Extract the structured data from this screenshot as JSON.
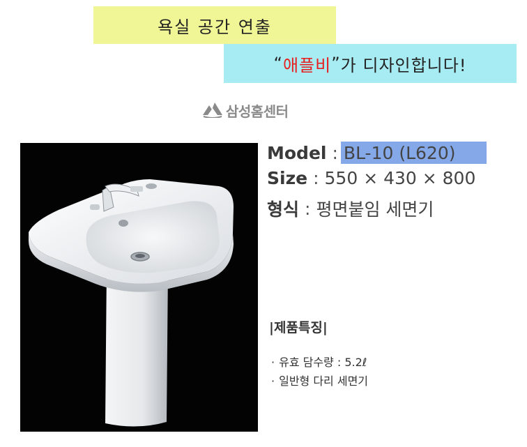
{
  "banner": {
    "line1": "욕실 공간 연출",
    "quote_open": "“",
    "brand": "애플비",
    "quote_close": "”",
    "line2_rest": "가 디자인합니다!"
  },
  "logo": {
    "text": "삼성홈센터"
  },
  "specs": {
    "model_label": "Model",
    "model_value": "BL-10 (L620)",
    "size_label": "Size",
    "size_value": "550 × 430 × 800",
    "type_label": "형식",
    "type_value": "평면붙임 세면기",
    "separator": ":"
  },
  "features": {
    "title": "|제품특징|",
    "bullet": "·",
    "items": [
      "유효 담수량 : 5.2ℓ",
      "일반형 다리 세면기"
    ]
  },
  "colors": {
    "banner1_bg": "#f0f596",
    "banner2_bg": "#a8ecf3",
    "brand_red": "#e61e1e",
    "model_highlight": "#85a8e8",
    "photo_bg": "#030303"
  }
}
